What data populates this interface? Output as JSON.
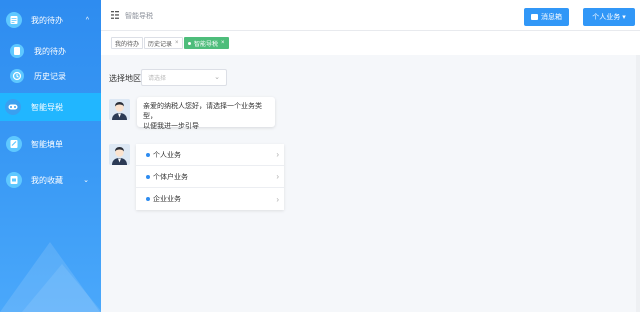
{
  "sidebar": {
    "items": [
      {
        "label": "我的待办",
        "icon": "todo-list-icon",
        "arrow": "^"
      },
      {
        "label": "我的待办",
        "icon": "todo-doc-icon"
      },
      {
        "label": "历史记录",
        "icon": "history-icon"
      },
      {
        "label": "智能导税",
        "icon": "tax-guide-icon"
      },
      {
        "label": "智能填单",
        "icon": "form-fill-icon"
      },
      {
        "label": "我的收藏",
        "icon": "favorites-icon",
        "arrow": "⌄"
      }
    ]
  },
  "header": {
    "title": "智能导税",
    "message_button": "消息箱",
    "business_button": "个人业务 ▾"
  },
  "tabs": [
    {
      "label": "我的待办"
    },
    {
      "label": "历史记录",
      "close": "×"
    },
    {
      "label": "智能导税",
      "close": "×"
    }
  ],
  "region": {
    "label": "选择地区",
    "placeholder": "请选择"
  },
  "chat": {
    "greeting_line1": "亲爱的纳税人您好，请选择一个业务类型，",
    "greeting_line2": "以便我进一步引导"
  },
  "options": [
    {
      "label": "个人业务"
    },
    {
      "label": "个体户业务"
    },
    {
      "label": "企业业务"
    }
  ],
  "colors": {
    "sidebar": "#2e8cf0",
    "active_item": "#21b6ff",
    "primary": "#3197f7",
    "tag_active": "#4ebd7b"
  }
}
